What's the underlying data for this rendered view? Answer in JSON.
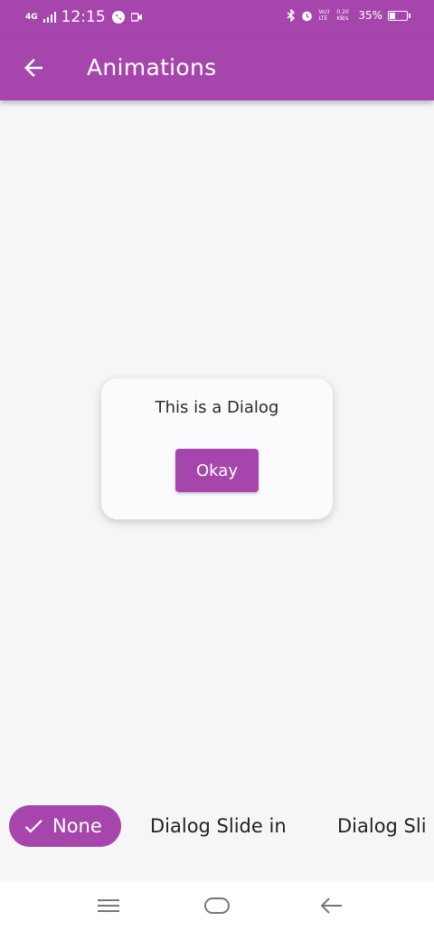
{
  "status_bar": {
    "network": "4G",
    "time": "12:15",
    "volte": "Vo)) LTE",
    "speed": "0.20 KB/s",
    "battery_percent": "35%",
    "battery_level": 0.35
  },
  "app_bar": {
    "title": "Animations",
    "back_icon": "arrow-back-icon",
    "color": "#a646ad"
  },
  "dialog": {
    "text": "This is a Dialog",
    "button_label": "Okay"
  },
  "chips": {
    "selected": {
      "label": "None",
      "icon": "check-icon"
    },
    "items": [
      {
        "label": "Dialog Slide in"
      },
      {
        "label": "Dialog Sli"
      }
    ]
  },
  "nav_bar": {
    "icons": [
      "menu-icon",
      "home-icon",
      "back-icon"
    ]
  }
}
